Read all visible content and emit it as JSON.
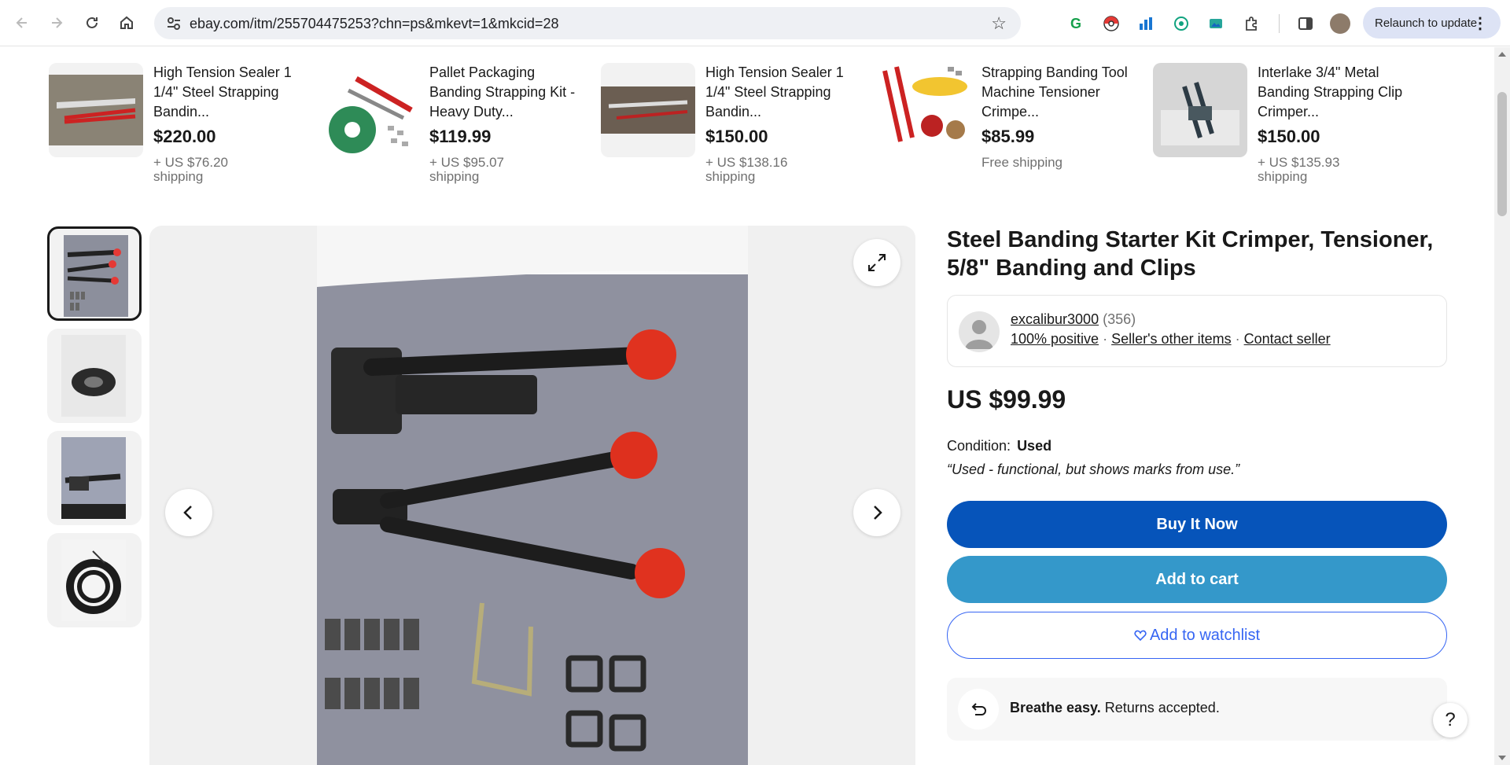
{
  "browser": {
    "url": "ebay.com/itm/255704475253?chn=ps&mkevt=1&mkcid=28",
    "relaunch_label": "Relaunch to update"
  },
  "related_items": [
    {
      "title": "High Tension Sealer 1 1/4\" Steel Strapping Bandin...",
      "price": "$220.00",
      "shipping": "+ US $76.20 shipping"
    },
    {
      "title": "Pallet Packaging Banding Strapping Kit - Heavy Duty...",
      "price": "$119.99",
      "shipping": "+ US $95.07 shipping"
    },
    {
      "title": "High Tension Sealer 1 1/4\" Steel Strapping Bandin...",
      "price": "$150.00",
      "shipping": "+ US $138.16 shipping"
    },
    {
      "title": "Strapping Banding Tool Machine Tensioner Crimpe...",
      "price": "$85.99",
      "shipping": "Free shipping"
    },
    {
      "title": "Interlake 3/4\" Metal Banding Strapping Clip Crimper...",
      "price": "$150.00",
      "shipping": "+ US $135.93 shipping"
    }
  ],
  "product": {
    "title": "Steel Banding Starter Kit Crimper, Tensioner, 5/8\" Banding and Clips",
    "price": "US $99.99",
    "condition_label": "Condition:",
    "condition_value": "Used",
    "condition_desc": "“Used - functional, but shows marks from use.”"
  },
  "seller": {
    "name": "excalibur3000",
    "count": "(356)",
    "positive": "100% positive",
    "other_items": "Seller's other items",
    "contact": "Contact seller"
  },
  "buttons": {
    "buy": "Buy It Now",
    "cart": "Add to cart",
    "watch": "Add to watchlist"
  },
  "returns": {
    "bold": "Breathe easy.",
    "text": " Returns accepted."
  },
  "help_label": "?",
  "colors": {
    "buy_button": "#0654ba",
    "cart_button": "#3498ca",
    "watch_border": "#3665f3"
  }
}
